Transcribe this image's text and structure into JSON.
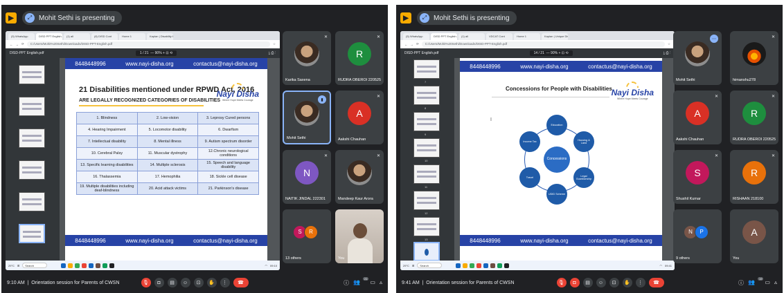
{
  "left": {
    "presenter": "Mohit Sethi is presenting",
    "time": "9:10 AM",
    "meeting": "Orientation session for Parents of CWSN",
    "browser": {
      "tabs": [
        "(5) WhatsApp",
        "DISD PPT English.pdf",
        "(1) all",
        "(8) DISD Cont",
        "Home 1",
        "Kaplan | Disability Help"
      ],
      "url": "C:/Users/Mohit%20Sethi/Downloads/DISD-PPT-English.pdf",
      "pdf_name": "DISD-PPT English.pdf",
      "page_ctrl": "1 / 21",
      "zoom": "90%"
    },
    "slide": {
      "phone": "8448448996",
      "web": "www.nayi-disha.org",
      "email": "contactus@nayi-disha.org",
      "title": "21 Disabilities mentioned under RPWD Act, 2016",
      "subtitle": "ARE LEGALLY RECOGNIZED CATEGORIES OF DISABILITIES",
      "logo": "Nayi Disha",
      "logo_tag": "Where Hope Meets Courage",
      "table": [
        [
          "1. Blindness",
          "2. Low-vision",
          "3. Leprosy Cured persons"
        ],
        [
          "4. Hearing Impairment",
          "5. Locomotor disability",
          "6. Dwarfism"
        ],
        [
          "7. Intellectual disability",
          "8. Mental illness",
          "9. Autism spectrum disorder"
        ],
        [
          "10. Cerebral Palsy",
          "11. Muscular dystrophy",
          "12.Chronic neurological conditions"
        ],
        [
          "13. Specific learning disabilities",
          "14. Multiple sclerosis",
          "15. Speech and language disability"
        ],
        [
          "16. Thalassemia",
          "17. Hemophilia",
          "18. Sickle cell disease"
        ],
        [
          "19. Multiple disabilities including deaf-blindness",
          "20. Acid attack victims",
          "21. Parkinson's disease"
        ]
      ]
    },
    "taskbar": {
      "weather": "29°C",
      "search": "Search",
      "clock": "09:10"
    },
    "tiles": [
      {
        "name": "Karika Saxena"
      },
      {
        "name": "RUDRA OBEROI 220525",
        "initial": "R",
        "color": "#1e8e3e"
      },
      {
        "name": "Mohit Sethi"
      },
      {
        "name": "Aakshi Chauhan",
        "initial": "A",
        "color": "#d93025"
      },
      {
        "name": "NAITIK JINDAL 222301",
        "initial": "N",
        "color": "#7e57c2"
      },
      {
        "name": "Mandeep Kaur Arora"
      },
      {
        "name": "13 others",
        "i1": "S",
        "i2": "R"
      },
      {
        "name": "You"
      }
    ],
    "people_count": "21"
  },
  "right": {
    "presenter": "Mohit Sethi is presenting",
    "time": "9:41 AM",
    "meeting": "Orientation session for Parents of CWSN",
    "browser": {
      "tabs": [
        "(5) WhatsApp",
        "DISD PPT English.pdf",
        "(1) all",
        "VDCAT Cont",
        "Home 1",
        "Kaplan | Unique Disability"
      ],
      "url": "C:/Users/Mohit%20Sethi/Downloads/DISD-PPT-English.pdf",
      "pdf_name": "DISD-PPT English.pdf",
      "page_ctrl": "14 / 21",
      "zoom": "90%"
    },
    "slide": {
      "phone": "8448448996",
      "web": "www.nayi-disha.org",
      "email": "contactus@nayi-disha.org",
      "title": "Concessions for People with Disabilities",
      "logo": "Nayi Disha",
      "logo_tag": "Where Hope Meets Courage",
      "center": "Concessions",
      "nodes": [
        "Education",
        "Housing & Land",
        "Legal Guardianship",
        "UDID Scheme",
        "Travel",
        "Income Tax"
      ]
    },
    "thumb_nums": [
      "7",
      "8",
      "9",
      "10",
      "11",
      "12",
      "13",
      "14"
    ],
    "taskbar": {
      "weather": "29°C",
      "search": "Search",
      "clock": "09:41"
    },
    "tiles": [
      {
        "name": "Mohit Sethi"
      },
      {
        "name": "himanshu278"
      },
      {
        "name": "Aakshi Chauhan",
        "initial": "A",
        "color": "#d93025"
      },
      {
        "name": "RUDRA OBEROI 220525",
        "initial": "R",
        "color": "#1e8e3e"
      },
      {
        "name": "Shushil Kumar",
        "initial": "S",
        "color": "#c2185b"
      },
      {
        "name": "RISHAAN 218100",
        "initial": "R",
        "color": "#e8710a"
      },
      {
        "name": "9 others",
        "i1": "N",
        "i2": "P"
      },
      {
        "name": "You",
        "initial": "A",
        "color": "#795548"
      }
    ],
    "people_count": "19"
  }
}
